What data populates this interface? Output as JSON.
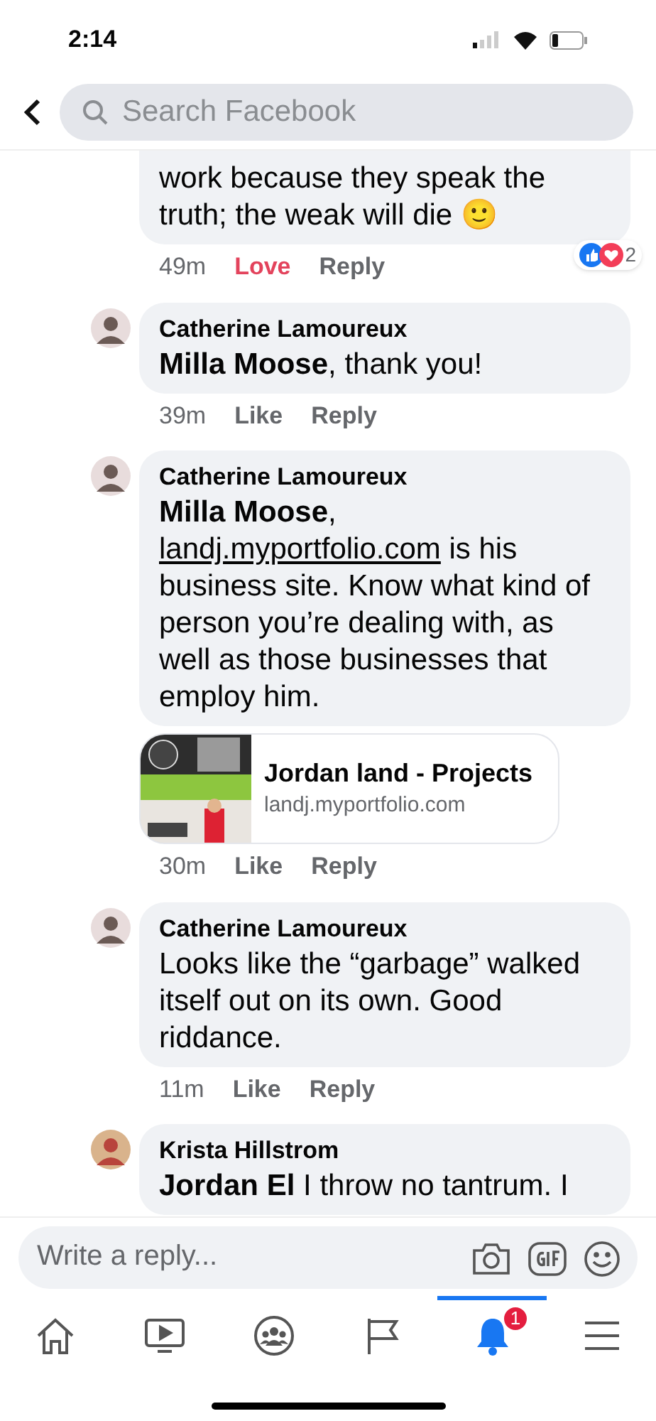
{
  "status_bar": {
    "time": "2:14"
  },
  "search": {
    "placeholder": "Search Facebook"
  },
  "comments": [
    {
      "segments": [
        {
          "kind": "plain",
          "text": "work because they speak the truth; the weak will die 🙂"
        }
      ],
      "time": "49m",
      "react": {
        "label": "Love",
        "selected": true
      },
      "reply": "Reply",
      "reactions": {
        "count": "2"
      },
      "clipped_top": true
    },
    {
      "author": "Catherine Lamoureux",
      "segments": [
        {
          "kind": "mention",
          "text": "Milla Moose"
        },
        {
          "kind": "plain",
          "text": ", thank you!"
        }
      ],
      "time": "39m",
      "react": {
        "label": "Like",
        "selected": false
      },
      "reply": "Reply"
    },
    {
      "author": "Catherine Lamoureux",
      "segments": [
        {
          "kind": "mention",
          "text": "Milla Moose"
        },
        {
          "kind": "plain",
          "text": ", "
        },
        {
          "kind": "link",
          "text": "landj.myportfolio.com"
        },
        {
          "kind": "plain",
          "text": " is his business site.  Know what kind of person you’re dealing with, as well as those businesses that employ him."
        }
      ],
      "link_preview": {
        "title": "Jordan land - Projects",
        "domain": "landj.myportfolio.com"
      },
      "time": "30m",
      "react": {
        "label": "Like",
        "selected": false
      },
      "reply": "Reply"
    },
    {
      "author": "Catherine Lamoureux",
      "segments": [
        {
          "kind": "plain",
          "text": "Looks like the “garbage” walked itself out on its own. Good riddance."
        }
      ],
      "time": "11m",
      "react": {
        "label": "Like",
        "selected": false
      },
      "reply": "Reply"
    },
    {
      "author": "Krista Hillstrom",
      "segments": [
        {
          "kind": "mention",
          "text": "Jordan El"
        },
        {
          "kind": "plain",
          "text": " I throw no tantrum. I"
        }
      ]
    }
  ],
  "composer": {
    "placeholder": "Write a reply..."
  },
  "tabs": [
    {
      "kind": "home",
      "selected": false
    },
    {
      "kind": "video",
      "selected": false
    },
    {
      "kind": "groups",
      "selected": false
    },
    {
      "kind": "pages",
      "selected": false
    },
    {
      "kind": "notifications",
      "selected": true,
      "badge": "1"
    },
    {
      "kind": "menu",
      "selected": false
    }
  ]
}
